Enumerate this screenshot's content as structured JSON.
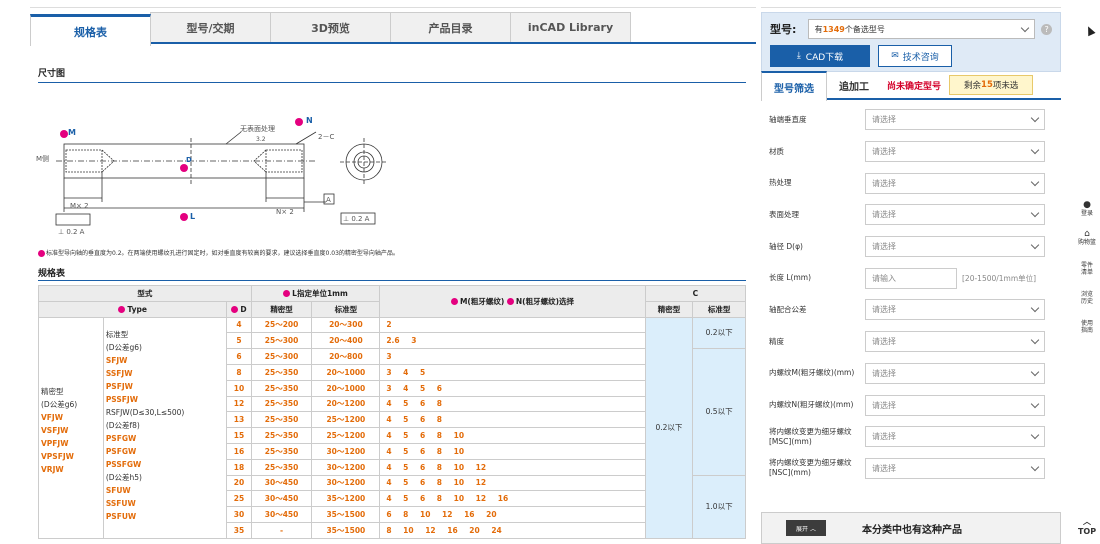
{
  "tabs": [
    "规格表",
    "型号/交期",
    "3D预览",
    "产品目录",
    "inCAD Library"
  ],
  "sections": {
    "dim_title": "尺寸图",
    "spec_title": "规格表"
  },
  "drawing": {
    "m_label": "M",
    "n_label": "N",
    "l_label": "L",
    "d_label": "D",
    "m_side": "M侧",
    "no_surface": "无表面处理",
    "c_label": "2－C",
    "mx2": "M× 2",
    "nx2": "N× 2",
    "perp": "⊥ 0.2 A",
    "datum": "A",
    "rough": "3.2"
  },
  "note": "标准型导向轴的垂直度为0.2。在两端使用螺纹孔进行固定时，如对垂直度有较高的要求，建议选择垂直度0.03的精密型导向轴产品。",
  "table": {
    "h_type": "型式",
    "h_type_sub": "Type",
    "h_d": "D",
    "h_l": "L指定单位1mm",
    "h_l_prec": "精密型",
    "h_l_std": "标准型",
    "h_mn": "M(粗牙螺纹)",
    "h_mn2": "N(粗牙螺纹)选择",
    "h_c": "C",
    "h_c_prec": "精密型",
    "h_c_std": "标准型",
    "group_label": [
      "精密型",
      "(D公差g6)"
    ],
    "group_codes": [
      "VFJW",
      "VSFJW",
      "VPFJW",
      "VPSFJW",
      "VRJW"
    ],
    "type_col_plain": [
      "标准型",
      "(D公差g6)"
    ],
    "type_col_codes1": [
      "SFJW",
      "SSFJW",
      "PSFJW",
      "PSSFJW"
    ],
    "type_col_rsfjw": "RSFJW(D≤30,L≤500)",
    "type_col_f8": "(D公差f8)",
    "type_col_codes2": [
      "PSFGW",
      "PSFGW",
      "PSSFGW"
    ],
    "type_col_h5": "(D公差h5)",
    "type_col_codes3": [
      "SFUW",
      "SSFUW",
      "PSFUW",
      "PSSFUW"
    ],
    "rows": [
      {
        "d": "4",
        "lp": "25～200",
        "ls": "20～300",
        "m": "2"
      },
      {
        "d": "5",
        "lp": "25～300",
        "ls": "20～400",
        "m": "2.6 3"
      },
      {
        "d": "6",
        "lp": "25～300",
        "ls": "20～800",
        "m": "3"
      },
      {
        "d": "8",
        "lp": "25～350",
        "ls": "20～1000",
        "m": "3 4 5"
      },
      {
        "d": "10",
        "lp": "25～350",
        "ls": "20～1000",
        "m": "3 4 5 6"
      },
      {
        "d": "12",
        "lp": "25～350",
        "ls": "20～1200",
        "m": "4 5 6 8"
      },
      {
        "d": "13",
        "lp": "25～350",
        "ls": "25～1200",
        "m": "4 5 6 8"
      },
      {
        "d": "15",
        "lp": "25～350",
        "ls": "25～1200",
        "m": "4 5 6 8 10"
      },
      {
        "d": "16",
        "lp": "25～350",
        "ls": "30～1200",
        "m": "4 5 6 8 10"
      },
      {
        "d": "18",
        "lp": "25～350",
        "ls": "30～1200",
        "m": "4 5 6 8 10 12"
      },
      {
        "d": "20",
        "lp": "30～450",
        "ls": "30～1200",
        "m": "4 5 6 8 10 12"
      },
      {
        "d": "25",
        "lp": "30～450",
        "ls": "35～1200",
        "m": "4 5 6 8 10 12 16"
      },
      {
        "d": "30",
        "lp": "30～450",
        "ls": "35～1500",
        "m": "6 8 10 12 16 20"
      },
      {
        "d": "35",
        "lp": "-",
        "ls": "35～1500",
        "m": "8 10 12 16 20 24"
      }
    ],
    "c_prec": "0.2以下",
    "c_std": [
      "0.2以下",
      "0.5以下",
      "1.0以下"
    ]
  },
  "model": {
    "label": "型号:",
    "select_prefix": "有",
    "count": "1349",
    "select_suffix": "个备选型号",
    "cad_btn": "CAD下载",
    "consult_btn": "技术咨询"
  },
  "rtabs": {
    "filter": "型号筛选",
    "extra": "追加工",
    "undetermined": "尚未确定型号",
    "remain_prefix": "剩余",
    "remain_count": "15",
    "remain_suffix": "项未选"
  },
  "filters": [
    {
      "label": "轴端垂直度",
      "type": "select",
      "placeholder": "请选择"
    },
    {
      "label": "材质",
      "type": "select",
      "placeholder": "请选择"
    },
    {
      "label": "热处理",
      "type": "select",
      "placeholder": "请选择"
    },
    {
      "label": "表面处理",
      "type": "select",
      "placeholder": "请选择"
    },
    {
      "label": "轴径 D(φ)",
      "type": "select",
      "placeholder": "请选择"
    },
    {
      "label": "长度 L(mm)",
      "type": "input",
      "placeholder": "请输入",
      "hint": "[20-1500/1mm单位]"
    },
    {
      "label": "轴配合公差",
      "type": "select",
      "placeholder": "请选择"
    },
    {
      "label": "精度",
      "type": "select",
      "placeholder": "请选择"
    },
    {
      "label": "内螺纹M(粗牙螺纹)(mm)",
      "type": "select",
      "placeholder": "请选择"
    },
    {
      "label": "内螺纹N(粗牙螺纹)(mm)",
      "type": "select",
      "placeholder": "请选择"
    },
    {
      "label": "将内螺纹变更为细牙螺纹[MSC](mm)",
      "type": "select",
      "placeholder": "请选择"
    },
    {
      "label": "将内螺纹变更为细牙螺纹[NSC](mm)",
      "type": "select",
      "placeholder": "请选择"
    }
  ],
  "bottom": {
    "expand": "展开 ︿",
    "title": "本分类中也有这种产品"
  },
  "rail": [
    {
      "icon": "person-icon",
      "glyph": "👤",
      "label": "登录"
    },
    {
      "icon": "cart-icon",
      "glyph": "🛒",
      "label": "购物篮"
    },
    {
      "icon": "list-icon",
      "glyph": "",
      "label": "零件清单"
    },
    {
      "icon": "history-icon",
      "glyph": "",
      "label": "浏览历史"
    },
    {
      "icon": "guide-icon",
      "glyph": "",
      "label": "使用指南"
    }
  ],
  "top_label": "TOP",
  "colors": {
    "accent": "#1a5fa8",
    "orange": "#e36c0a",
    "magenta": "#e4007f",
    "lightblue": "#dbeefb"
  }
}
